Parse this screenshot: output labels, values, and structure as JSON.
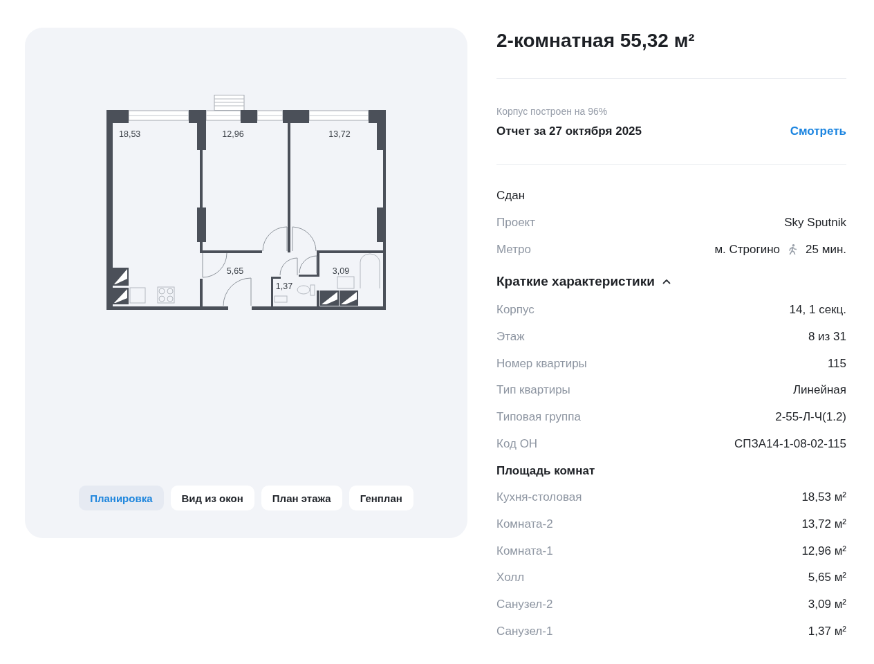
{
  "gallery": {
    "floor_plan": {
      "rooms": [
        {
          "area": "18,53"
        },
        {
          "area": "12,96"
        },
        {
          "area": "13,72"
        },
        {
          "area": "5,65"
        },
        {
          "area": "1,37"
        },
        {
          "area": "3,09"
        }
      ]
    },
    "tabs": [
      {
        "label": "Планировка",
        "selected": true
      },
      {
        "label": "Вид из окон",
        "selected": false
      },
      {
        "label": "План этажа",
        "selected": false
      },
      {
        "label": "Генплан",
        "selected": false
      }
    ]
  },
  "title": "2-комнатная 55,32 м²",
  "construction": {
    "progress_text": "Корпус построен на 96%",
    "report": "Отчет за 27 октября 2025",
    "link": "Смотреть"
  },
  "status": "Сдан",
  "details": [
    {
      "kind": "text",
      "label": "Проект",
      "value": "Sky Sputnik"
    },
    {
      "kind": "metro",
      "label": "Метро",
      "station": "м. Строгино",
      "walk_time": "25 мин."
    }
  ],
  "characteristics": {
    "title": "Краткие характеристики",
    "expanded": true,
    "rows": [
      {
        "label": "Корпус",
        "value": "14, 1 секц."
      },
      {
        "label": "Этаж",
        "value": "8 из 31"
      },
      {
        "label": "Номер квартиры",
        "value": "115"
      },
      {
        "label": "Тип квартиры",
        "value": "Линейная"
      },
      {
        "label": "Типовая группа",
        "value": "2-55-Л-Ч(1.2)"
      },
      {
        "label": "Код ОН",
        "value": "СПЗА14-1-08-02-115"
      }
    ],
    "rooms_title": "Площадь комнат",
    "rooms": [
      {
        "name": "Кухня-столовая",
        "area": "18,53 м²"
      },
      {
        "name": "Комната-2",
        "area": "13,72 м²"
      },
      {
        "name": "Комната-1",
        "area": "12,96 м²"
      },
      {
        "name": "Холл",
        "area": "5,65 м²"
      },
      {
        "name": "Санузел-2",
        "area": "3,09 м²"
      },
      {
        "name": "Санузел-1",
        "area": "1,37 м²"
      }
    ]
  }
}
